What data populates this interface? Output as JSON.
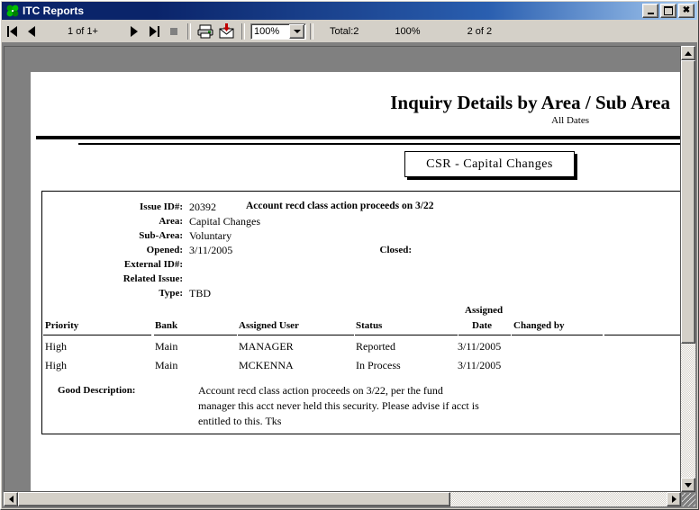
{
  "window": {
    "title": "ITC Reports",
    "icon": "clover-icon",
    "minimize_label": "Minimize",
    "maximize_label": "Maximize",
    "close_label": "Close"
  },
  "toolbar": {
    "first_page_label": "First Page",
    "prev_page_label": "Previous Page",
    "page_indicator": "1 of 1+",
    "next_page_label": "Next Page",
    "last_page_label": "Last Page",
    "stop_label": "Stop",
    "print_icon": "printer-icon",
    "export_icon": "export-envelope-icon",
    "zoom_value": "100%",
    "zoom_options": [
      "100%"
    ],
    "total_label": "Total:2",
    "scale_label": "100%",
    "position_label": "2 of 2"
  },
  "report": {
    "title": "Inquiry Details by Area / Sub Area",
    "subtitle": "All Dates",
    "area_banner": "CSR  -  Capital Changes",
    "fields": [
      {
        "label": "Issue ID#:",
        "value": "20392",
        "extra": "Account recd class action proceeds on 3/22"
      },
      {
        "label": "Area:",
        "value": "Capital Changes",
        "extra": ""
      },
      {
        "label": "Sub-Area:",
        "value": "Voluntary",
        "extra": ""
      },
      {
        "label": "Opened:",
        "value": "3/11/2005",
        "extra": ""
      },
      {
        "label": "External ID#:",
        "value": "",
        "extra": ""
      },
      {
        "label": "Related Issue:",
        "value": "",
        "extra": ""
      },
      {
        "label": "Type:",
        "value": "TBD",
        "extra": ""
      }
    ],
    "closed_label": "Closed:",
    "closed_value": "",
    "table": {
      "headers": [
        "Priority",
        "Bank",
        "Assigned User",
        "Status",
        "Assigned Date",
        "Changed by",
        ""
      ],
      "header_assigned_top": "Assigned",
      "header_assigned_bottom": "Date",
      "rows": [
        {
          "priority": "High",
          "bank": "Main",
          "assigned_user": "MANAGER",
          "status": "Reported",
          "assigned_date": "3/11/2005",
          "changed_by": ""
        },
        {
          "priority": "High",
          "bank": "Main",
          "assigned_user": "MCKENNA",
          "status": "In Process",
          "assigned_date": "3/11/2005",
          "changed_by": ""
        }
      ]
    },
    "description": {
      "label": "Good Description:",
      "lines": [
        "Account recd class action proceeds on 3/22, per the fund",
        "manager this acct never held this security.  Please advise if acct is",
        "entitled to this.  Tks"
      ]
    }
  },
  "scrollbars": {
    "vertical_up": "scroll-up",
    "vertical_down": "scroll-down",
    "horizontal_left": "scroll-left",
    "horizontal_right": "scroll-right"
  },
  "colors": {
    "titlebar_start": "#0a246a",
    "titlebar_end": "#a6caf0",
    "chrome": "#d4d0c8",
    "viewer_bg": "#808080",
    "page_bg": "#ffffff",
    "text": "#000000"
  }
}
